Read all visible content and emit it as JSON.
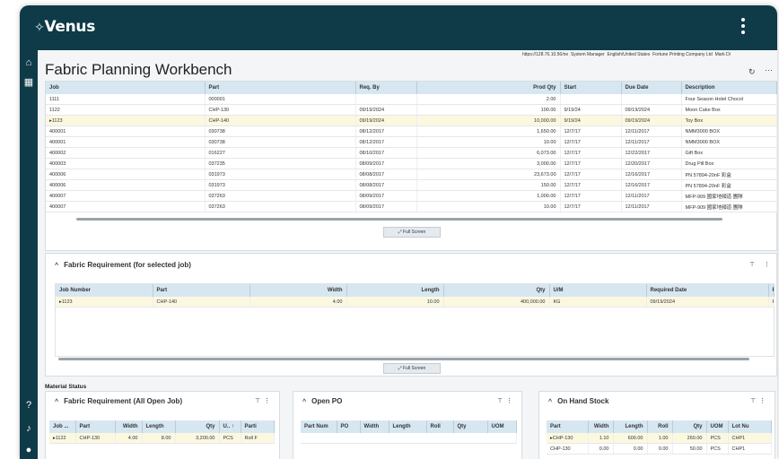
{
  "app": {
    "brand": "Venus"
  },
  "infobar": {
    "url": "https://128.76.10.56/ne",
    "role": "System Manager",
    "locale": "English/United States",
    "company": "Fortune Printing Company Ltd",
    "extra": "Mark Di"
  },
  "page": {
    "title": "Fabric Planning Workbench"
  },
  "jobs_table": {
    "columns": [
      "Job",
      "Part",
      "Req. By",
      "Prod Qty",
      "Start",
      "Due Date",
      "Description"
    ],
    "rows": [
      [
        "1111",
        "000001",
        "",
        "2.00",
        "",
        "",
        "Four Season Hotel Chocol"
      ],
      [
        "1122",
        "CHP-130",
        "09/19/2024",
        "100.00",
        "9/19/24",
        "09/19/2024",
        "Moon Cake Box"
      ],
      [
        "1123",
        "CHP-140",
        "09/19/2024",
        "10,000.00",
        "9/19/24",
        "09/19/2024",
        "Toy Box"
      ],
      [
        "400001",
        "030738",
        "08/12/2017",
        "1,650.00",
        "12/7/17",
        "12/11/2017",
        "NMM3000 BOX"
      ],
      [
        "400001",
        "030738",
        "08/12/2017",
        "10.00",
        "12/7/17",
        "12/11/2017",
        "NMM3000 BOX"
      ],
      [
        "400002",
        "016227",
        "08/10/2017",
        "6,073.00",
        "12/7/17",
        "12/22/2017",
        "Gift Box"
      ],
      [
        "400003",
        "037235",
        "08/09/2017",
        "3,000.00",
        "12/7/17",
        "12/20/2017",
        "Drug Pill Box"
      ],
      [
        "400006",
        "031973",
        "08/08/2017",
        "23,673.00",
        "12/7/17",
        "12/16/2017",
        "PN 57894-20nF 彩盒"
      ],
      [
        "400006",
        "031973",
        "08/08/2017",
        "150.00",
        "12/7/17",
        "12/16/2017",
        "PN 57894-20nF 彩盒"
      ],
      [
        "400007",
        "037263",
        "08/09/2017",
        "1,000.00",
        "12/7/17",
        "12/11/2017",
        "MFP-909 國家地頻道 團隊"
      ],
      [
        "400007",
        "037263",
        "08/09/2017",
        "10.00",
        "12/7/17",
        "12/11/2017",
        "MFP-909 國家地頻道 團隊"
      ]
    ],
    "selected_row": 2
  },
  "full_screen_label": "Full Screen",
  "fabric_req": {
    "title": "Fabric Requirement (for selected job)",
    "columns": [
      "Job Number",
      "Part",
      "Width",
      "Length",
      "Qty",
      "U/M",
      "Required Date",
      "P"
    ],
    "rows": [
      [
        "1123",
        "CHP-140",
        "4.00",
        "10.00",
        "400,000.00",
        "KG",
        "09/19/2024",
        "Re"
      ]
    ]
  },
  "material_status": {
    "label": "Material Status"
  },
  "open_job": {
    "title": "Fabric Requirement (All Open Job)",
    "columns": [
      "Job ...",
      "Part",
      "Width",
      "Length",
      "Qty",
      "U.. ↑",
      "Parti"
    ],
    "rows": [
      [
        "1122",
        "CHP-130",
        "4.00",
        "8.00",
        "3,200.00",
        "PCS",
        "Roll F"
      ]
    ]
  },
  "open_po": {
    "title": "Open PO",
    "columns": [
      "Part Num",
      "PO",
      "Width",
      "Length",
      "Roll",
      "Qty",
      "UOM"
    ]
  },
  "on_hand": {
    "title": "On Hand Stock",
    "columns": [
      "Part",
      "Width",
      "Length",
      "Roll",
      "Qty",
      "UOM",
      "Lot Nu"
    ],
    "rows": [
      [
        "CHP-130",
        "1.10",
        "600.00",
        "1.00",
        "260.00",
        "PCS",
        "CHP1"
      ],
      [
        "CHP-130",
        "0.00",
        "0.00",
        "0.00",
        "50.00",
        "PCS",
        "CHP1"
      ]
    ]
  },
  "icons": {
    "home": "home-icon",
    "apps": "apps-grid-icon",
    "help": "help-icon",
    "notify": "bell-icon",
    "user": "user-icon"
  },
  "colors": {
    "topbar": "#0f3a48",
    "header": "#d7e7f1",
    "selected": "#fcf8e0"
  }
}
